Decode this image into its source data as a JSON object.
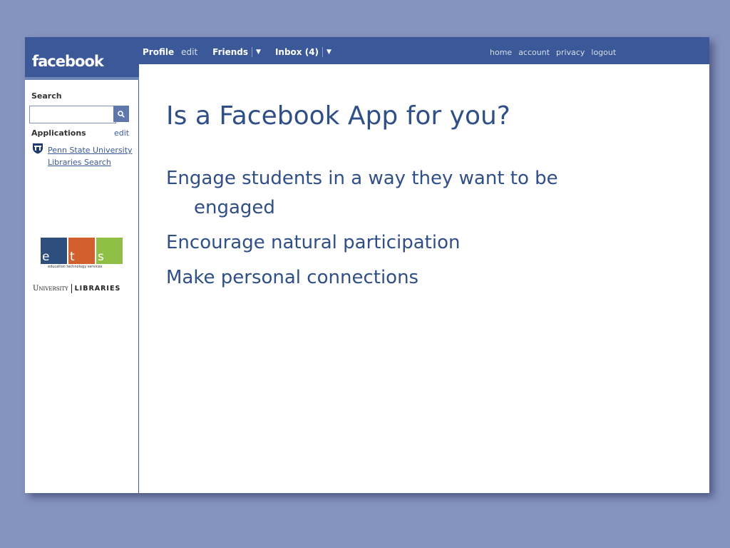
{
  "app": {
    "logo": "facebook"
  },
  "nav": {
    "profile": "Profile",
    "edit": "edit",
    "friends": "Friends",
    "inbox": "Inbox (4)"
  },
  "right_nav": [
    "home",
    "account",
    "privacy",
    "logout"
  ],
  "sidebar": {
    "search_label": "Search",
    "search_value": "",
    "applications_label": "Applications",
    "applications_edit": "edit",
    "app_link": "Penn State University Libraries Search",
    "ets_letters": [
      "e",
      "t",
      "s"
    ],
    "ets_caption": "education technology services",
    "unilib_university": "University",
    "unilib_libraries": "LIBRARIES"
  },
  "slide": {
    "title": "Is a Facebook App for you?",
    "bullet1_line1": "Engage students in a way they want to be",
    "bullet1_line2": "engaged",
    "bullet2": "Encourage natural participation",
    "bullet3": "Make personal connections"
  },
  "colors": {
    "background": "#8593bf",
    "facebook_blue": "#3b5998",
    "text_blue": "#2f4f86",
    "ets_blue": "#2e4e7e",
    "ets_orange": "#d2602e",
    "ets_green": "#8fbf45"
  }
}
